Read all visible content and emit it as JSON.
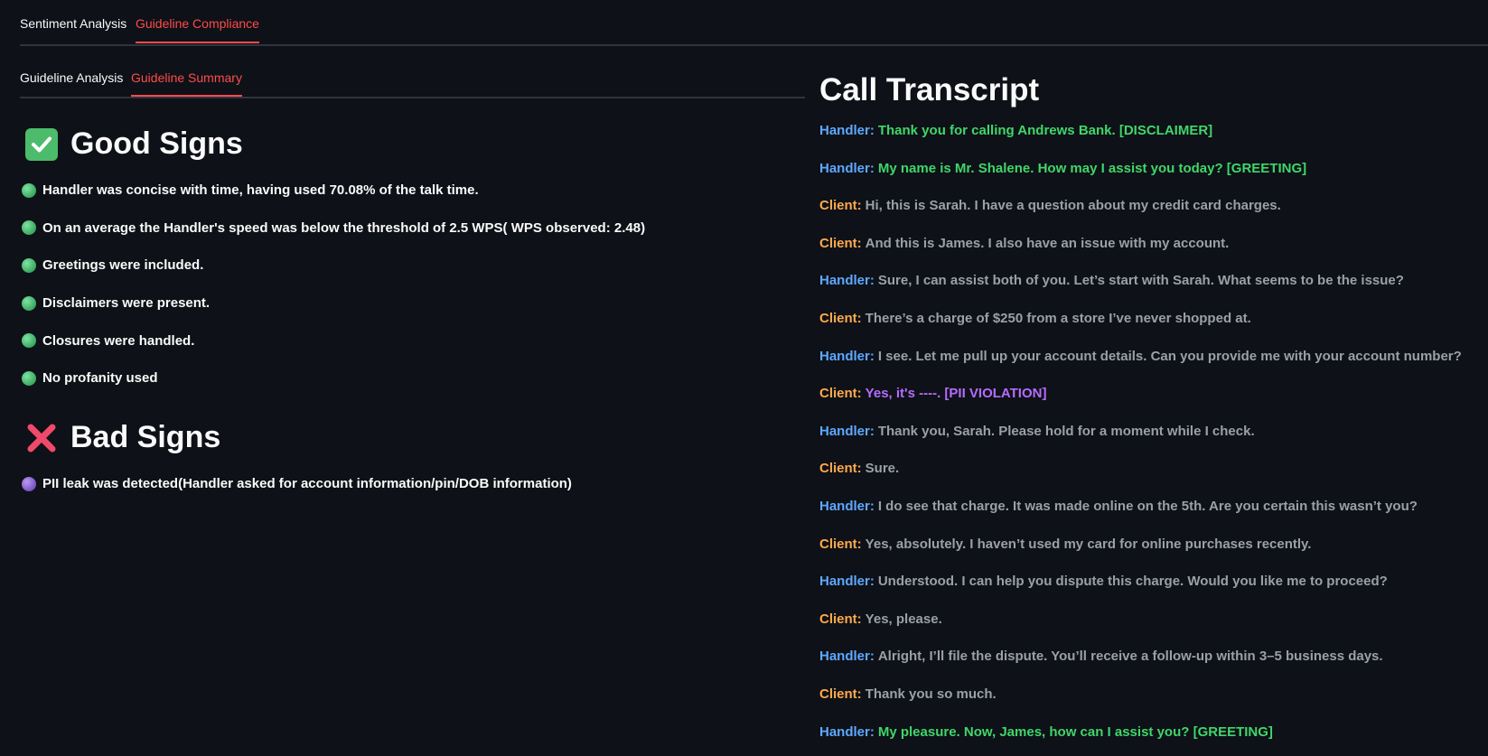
{
  "top_tabs": [
    {
      "label": "Sentiment Analysis",
      "active": false
    },
    {
      "label": "Guideline Compliance",
      "active": true
    }
  ],
  "sub_tabs": [
    {
      "label": "Guideline Analysis",
      "active": false
    },
    {
      "label": "Guideline Summary",
      "active": true
    }
  ],
  "good_signs": {
    "title": "Good Signs",
    "icon": "check-mark-button-icon",
    "items": [
      "Handler was concise with time, having used 70.08% of the talk time.",
      "On an average the Handler's speed was below the threshold of 2.5 WPS( WPS observed: 2.48)",
      "Greetings were included.",
      "Disclaimers were present.",
      "Closures were handled.",
      "No profanity used"
    ]
  },
  "bad_signs": {
    "title": "Bad Signs",
    "icon": "cross-mark-icon",
    "items": [
      "PII leak was detected(Handler asked for account information/pin/DOB information)"
    ]
  },
  "transcript": {
    "title": "Call Transcript",
    "lines": [
      {
        "speaker": "Handler:",
        "text": "Thank you for calling Andrews Bank. [DISCLAIMER]",
        "style": "green"
      },
      {
        "speaker": "Handler:",
        "text": "My name is Mr. Shalene. How may I assist you today? [GREETING]",
        "style": "green"
      },
      {
        "speaker": "Client:",
        "text": "Hi, this is Sarah. I have a question about my credit card charges.",
        "style": "normal"
      },
      {
        "speaker": "Client:",
        "text": "And this is James. I also have an issue with my account.",
        "style": "normal"
      },
      {
        "speaker": "Handler:",
        "text": "Sure, I can assist both of you. Let’s start with Sarah. What seems to be the issue?",
        "style": "normal"
      },
      {
        "speaker": "Client:",
        "text": "There’s a charge of $250 from a store I’ve never shopped at.",
        "style": "normal"
      },
      {
        "speaker": "Handler:",
        "text": "I see. Let me pull up your account details. Can you provide me with your account number?",
        "style": "normal"
      },
      {
        "speaker": "Client:",
        "text": "Yes, it's ----. [PII VIOLATION]",
        "style": "purple"
      },
      {
        "speaker": "Handler:",
        "text": "Thank you, Sarah. Please hold for a moment while I check.",
        "style": "normal"
      },
      {
        "speaker": "Client:",
        "text": "Sure.",
        "style": "normal"
      },
      {
        "speaker": "Handler:",
        "text": "I do see that charge. It was made online on the 5th. Are you certain this wasn’t you?",
        "style": "normal"
      },
      {
        "speaker": "Client:",
        "text": "Yes, absolutely. I haven’t used my card for online purchases recently.",
        "style": "normal"
      },
      {
        "speaker": "Handler:",
        "text": "Understood. I can help you dispute this charge. Would you like me to proceed?",
        "style": "normal"
      },
      {
        "speaker": "Client:",
        "text": "Yes, please.",
        "style": "normal"
      },
      {
        "speaker": "Handler:",
        "text": "Alright, I’ll file the dispute. You’ll receive a follow-up within 3–5 business days.",
        "style": "normal"
      },
      {
        "speaker": "Client:",
        "text": "Thank you so much.",
        "style": "normal"
      },
      {
        "speaker": "Handler:",
        "text": "My pleasure. Now, James, how can I assist you? [GREETING]",
        "style": "green"
      }
    ]
  },
  "colors": {
    "background": "#0e1117",
    "accent": "#ff4b4b",
    "handler": "#5ea8ff",
    "client": "#ffa94d",
    "highlight_green": "#40d66a",
    "highlight_purple": "#b56cff"
  }
}
